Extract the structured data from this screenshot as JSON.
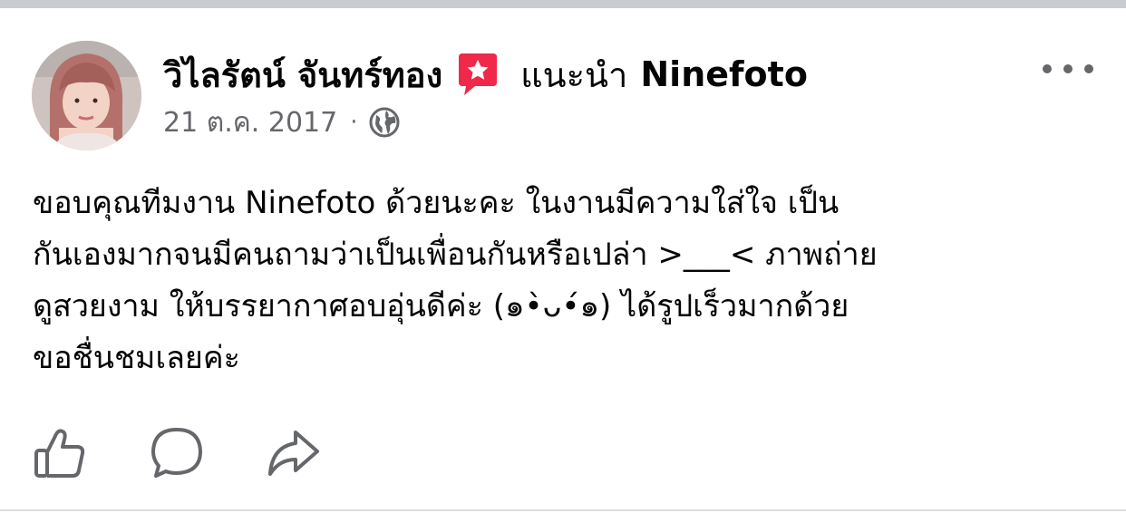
{
  "post": {
    "author_name": "วิไลรัตน์ จันทร์ทอง",
    "recommendation_icon": "star-badge-icon",
    "recommendation_verb": "แนะนำ",
    "recommended_page": "Ninefoto",
    "date": "21 ต.ค. 2017",
    "separator": "·",
    "audience_icon": "globe-icon",
    "more_icon": "more-options-icon",
    "body_lines": [
      "ขอบคุณทีมงาน Ninefoto ด้วยนะคะ ในงานมีความใส่ใจ เป็น",
      "กันเองมากจนมีคนถามว่าเป็นเพื่อนกันหรือเปล่า >___< ภาพถ่าย",
      "ดูสวยงาม ให้บรรยากาศอบอุ่นดีค่ะ (๑•̀ᴗ•́๑) ได้รูปเร็วมากด้วย",
      "ขอชื่นชมเลยค่ะ"
    ]
  },
  "actions": {
    "like_icon": "thumbs-up-icon",
    "comment_icon": "comment-bubble-icon",
    "share_icon": "share-arrow-icon"
  },
  "colors": {
    "text": "#050505",
    "secondary_text": "#65676b",
    "badge_red": "#f02849",
    "top_bar": "#c9ccd1"
  }
}
